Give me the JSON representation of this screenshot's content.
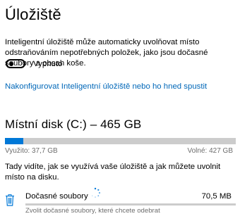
{
  "page": {
    "title": "Úložiště"
  },
  "storage_sense": {
    "description": "Inteligentní úložiště může automaticky uvolňovat místo odstraňováním nepotřebných položek, jako jsou dočasné soubory a obsah koše.",
    "toggle_state": "off",
    "toggle_label": "Vypnuto",
    "configure_link": "Nakonfigurovat Inteligentní úložiště nebo ho hned spustit"
  },
  "disk": {
    "title": "Místní disk (C:) – 465 GB",
    "used_label": "Využito: 37,7 GB",
    "free_label": "Volné: 427 GB",
    "used_fraction": 0.081,
    "info_text": "Tady vidíte, jak se využívá vaše úložiště a jak můžete uvolnit místo na disku."
  },
  "categories": [
    {
      "icon": "trash-icon",
      "name": "Dočasné soubory",
      "size": "70,5 MB",
      "description": "Zvolit dočasné soubory, které chcete odebrat",
      "loading": true,
      "fill_fraction": 0
    }
  ],
  "colors": {
    "accent": "#0078d7",
    "link": "#0067b8",
    "bar_track": "#cccccc",
    "secondary_text": "#6d6d6d"
  }
}
